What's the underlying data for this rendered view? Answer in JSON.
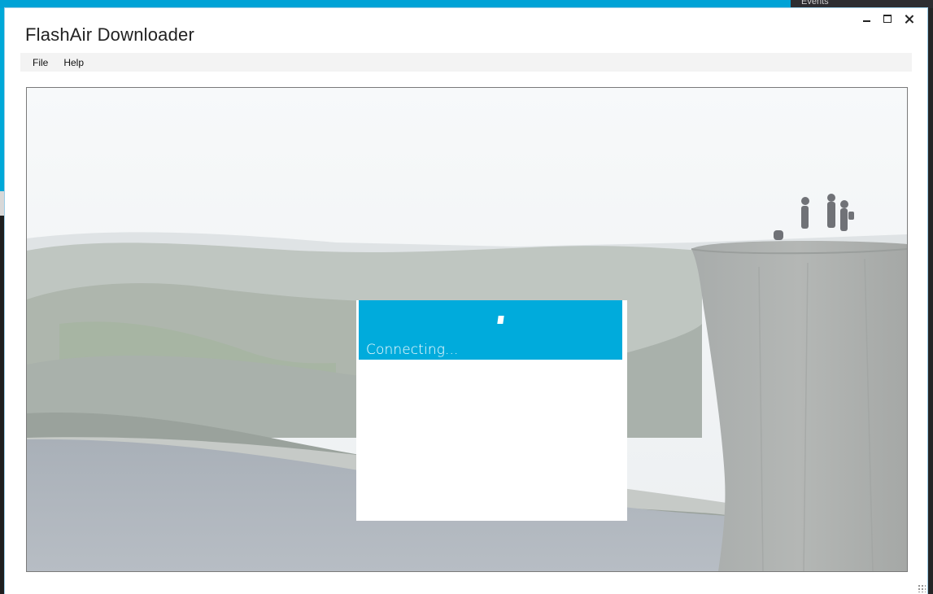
{
  "window": {
    "title": "FlashAir Downloader"
  },
  "menu": {
    "items": [
      "File",
      "Help"
    ]
  },
  "dialog": {
    "status": "Connecting..."
  },
  "background_app": {
    "panel_label": "Events"
  },
  "colors": {
    "accent": "#00abdc",
    "window_border": "#9ccde6",
    "menubar": "#f3f3f3"
  },
  "icons": [
    "minimize-icon",
    "maximize-icon",
    "close-icon",
    "spinner-icon",
    "resize-grip-icon"
  ]
}
